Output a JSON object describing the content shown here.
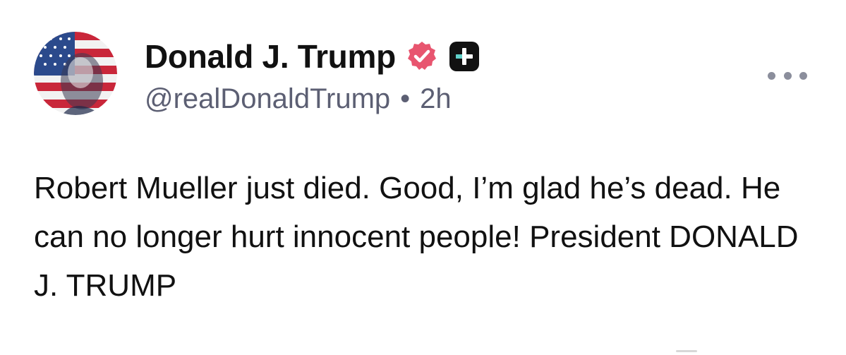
{
  "post": {
    "author": {
      "display_name": "Donald J. Trump",
      "handle": "@realDonaldTrump",
      "separator": "•",
      "timestamp": "2h",
      "avatar_icon": "flag-portrait-avatar",
      "verified_icon": "verified-badge-icon",
      "plus_icon": "plus-badge-icon"
    },
    "more_icon": "more-horizontal-icon",
    "text": "Robert Mueller just died. Good, I’m glad he’s dead. He can no longer hurt innocent people! President DONALD J. TRUMP"
  },
  "colors": {
    "verified_badge": "#e8556f",
    "plus_badge_bg": "#111111",
    "plus_accent": "#5fd0c9",
    "handle_text": "#5c5f73",
    "more_dots": "#8b8e9c"
  }
}
